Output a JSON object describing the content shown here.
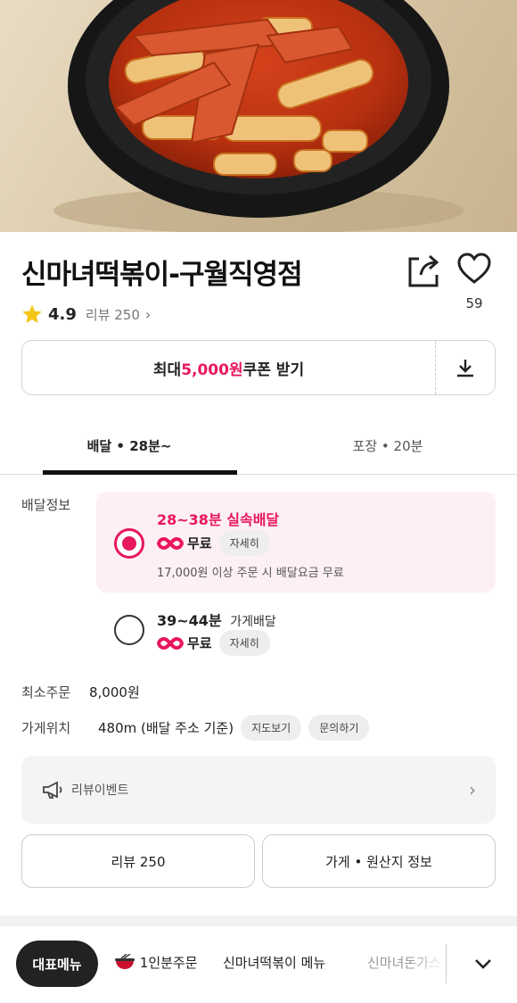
{
  "store": {
    "name": "신마녀떡볶이-구월직영점",
    "like_count": "59",
    "rating": "4.9",
    "review_link": "리뷰 250"
  },
  "coupon": {
    "prefix": "최대 ",
    "amount": "5,000원",
    "suffix": " 쿠폰 받기"
  },
  "tabs": [
    {
      "label": "배달 • 28분~",
      "active": true
    },
    {
      "label": "포장 • 20분",
      "active": false
    }
  ],
  "delivery": {
    "section_label": "배달정보",
    "options": [
      {
        "time": "28~38분",
        "type": "실속배달",
        "fee": "무료",
        "detail_chip": "자세히",
        "note": "17,000원 이상 주문 시 배달요금 무료",
        "selected": true
      },
      {
        "time": "39~44분",
        "type": "가게배달",
        "fee": "무료",
        "detail_chip": "자세히",
        "selected": false
      }
    ],
    "min_order_label": "최소주문",
    "min_order_value": "8,000원",
    "location_label": "가게위치",
    "location_value": "480m (배달 주소 기준)",
    "map_chip": "지도보기",
    "contact_chip": "문의하기"
  },
  "event": {
    "label": "리뷰이벤트"
  },
  "buttons": {
    "reviews": "리뷰 250",
    "store_info": "가게 • 원산지 정보"
  },
  "menubar": {
    "active": "대표메뉴",
    "items": [
      "1인분주문",
      "신마녀떡볶이 메뉴",
      "신마녀돈가스"
    ]
  },
  "colors": {
    "accent": "#e8175d",
    "accent_bg": "#fdf0f3",
    "star": "#f5c518"
  }
}
